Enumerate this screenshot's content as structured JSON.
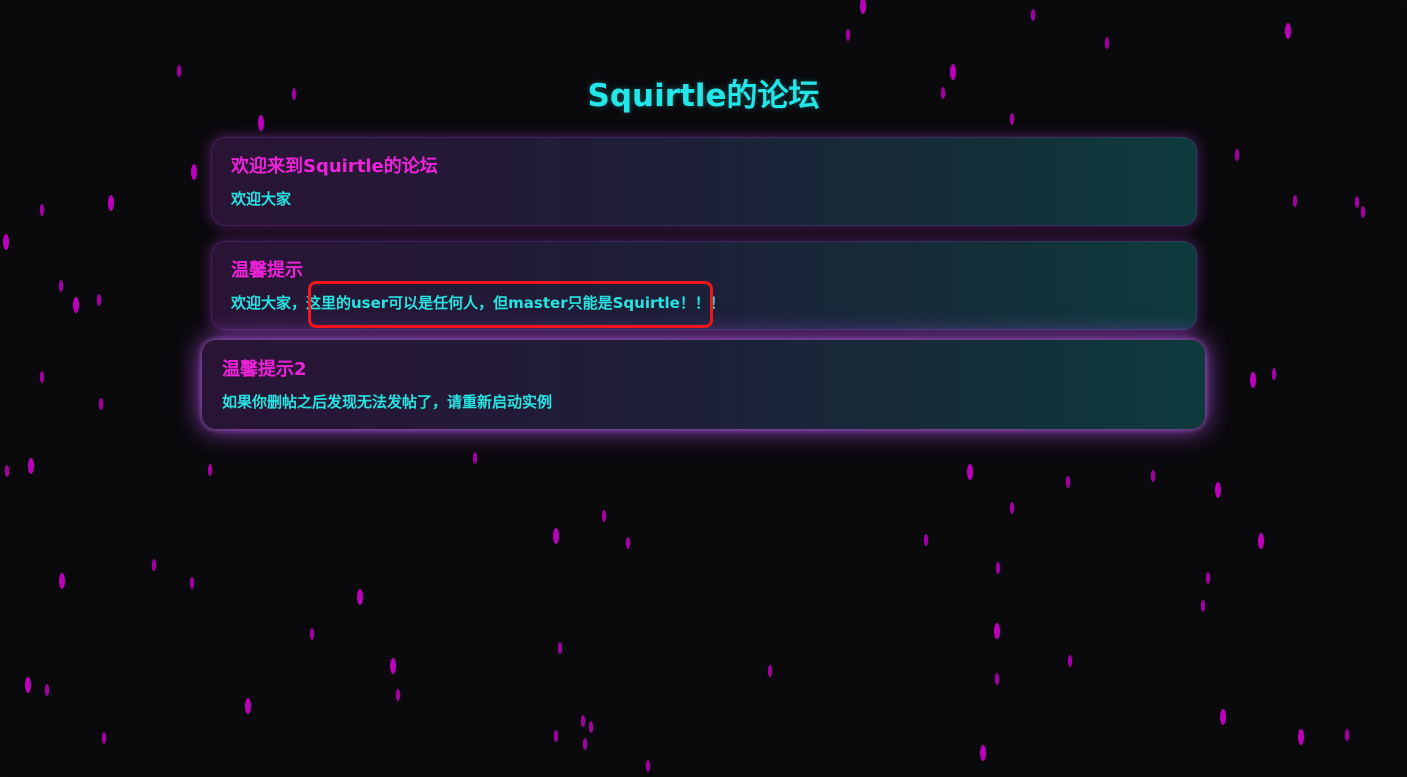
{
  "page": {
    "title": "Squirtle的论坛"
  },
  "posts": [
    {
      "title": "欢迎来到Squirtle的论坛",
      "body": "欢迎大家"
    },
    {
      "title": "温馨提示",
      "body": "欢迎大家，这里的user可以是任何人，但master只能是Squirtle！！！"
    },
    {
      "title": "温馨提示2",
      "body": "如果你删帖之后发现无法发帖了，请重新启动实例"
    }
  ],
  "colors": {
    "background": "#0a090c",
    "title": "#22e6e8",
    "post_title": "#ee22d9",
    "post_body": "#27e3e2",
    "rain_drops": "#c800c8",
    "highlight_box": "#f2151a"
  }
}
